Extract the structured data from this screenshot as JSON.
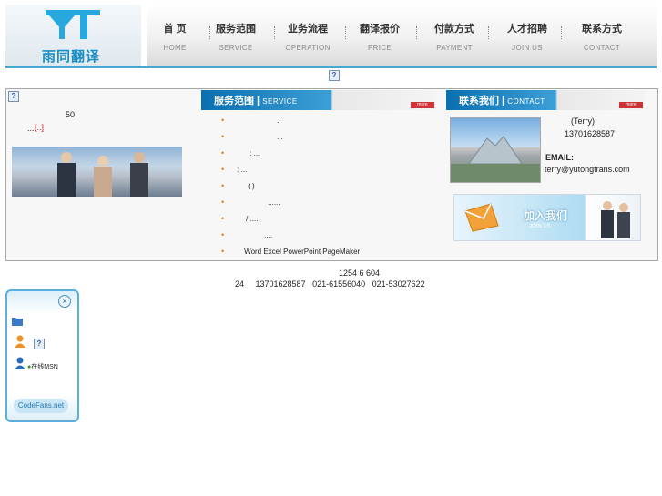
{
  "header": {
    "logo_text": "雨同翻译",
    "nav": [
      {
        "cn": "首 页",
        "en": "HOME"
      },
      {
        "cn": "服务范围",
        "en": "SERVICE"
      },
      {
        "cn": "业务流程",
        "en": "OPERATION"
      },
      {
        "cn": "翻译报价",
        "en": "PRICE"
      },
      {
        "cn": "付款方式",
        "en": "PAYMENT"
      },
      {
        "cn": "人才招聘",
        "en": "JOIN US"
      },
      {
        "cn": "联系方式",
        "en": "CONTACT"
      }
    ]
  },
  "broken_image_glyph": "?",
  "about": {
    "number": "50",
    "more_dots": "....",
    "more_link": "[..]"
  },
  "services": {
    "title_cn": "服务范围",
    "title_en": "SERVICE",
    "more": "more",
    "items": [
      "..",
      "...",
      ":          ...",
      ":          ...",
      "(       )",
      "......",
      "/         ....",
      "....",
      "Word Excel PowerPoint PageMaker"
    ]
  },
  "contact": {
    "title_cn": "联系我们",
    "title_en": "CONTACT",
    "more": "more",
    "name": "(Terry)",
    "phone": "13701628587",
    "email_label": "EMAIL:",
    "email": "terry@yutongtrans.com",
    "join_banner": "加入我们",
    "join_banner_sub": "JOIN US"
  },
  "footer": {
    "line1": "1254 6 604",
    "line2": "24     13701628587   021-61556040   021-53027622"
  },
  "float_panel": {
    "status_text": "在线MSN",
    "brand": "CodeFans.net",
    "close": "×"
  }
}
